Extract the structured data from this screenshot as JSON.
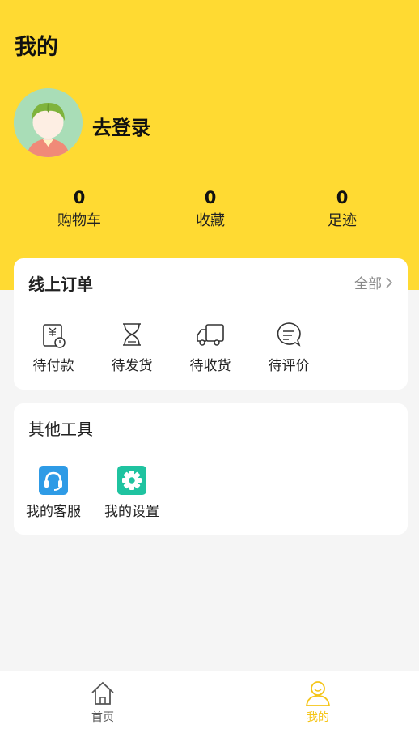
{
  "header": {
    "title": "我的"
  },
  "profile": {
    "login_label": "去登录"
  },
  "stats": [
    {
      "value": "0",
      "label": "购物车"
    },
    {
      "value": "0",
      "label": "收藏"
    },
    {
      "value": "0",
      "label": "足迹"
    }
  ],
  "orders": {
    "title": "线上订单",
    "all_label": "全部",
    "items": [
      {
        "label": "待付款",
        "icon": "payment-pending-icon"
      },
      {
        "label": "待发货",
        "icon": "hourglass-icon"
      },
      {
        "label": "待收货",
        "icon": "truck-icon"
      },
      {
        "label": "待评价",
        "icon": "comment-icon"
      }
    ]
  },
  "tools": {
    "title": "其他工具",
    "items": [
      {
        "label": "我的客服",
        "icon": "headset-icon"
      },
      {
        "label": "我的设置",
        "icon": "gear-icon"
      }
    ]
  },
  "tabbar": {
    "items": [
      {
        "label": "首页",
        "icon": "home-icon",
        "active": false
      },
      {
        "label": "我的",
        "icon": "user-icon",
        "active": true
      }
    ]
  },
  "colors": {
    "brand_yellow": "#FFDA32",
    "active_tab": "#F5C518",
    "service_blue": "#2E9BE6",
    "settings_green": "#1FC3A0"
  }
}
